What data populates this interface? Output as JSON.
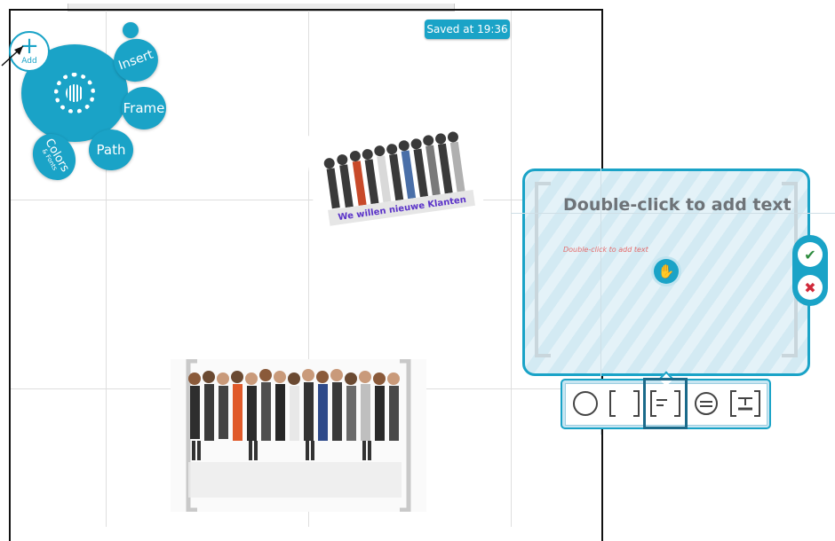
{
  "saved_badge": "Saved at 19:36",
  "bubble_menu": {
    "add_label": "Add",
    "insert": "Insert",
    "frame": "Frame",
    "path": "Path",
    "colors": "Colors",
    "colors_sub": "& Fonts"
  },
  "image_caption": "We willen nieuwe Klanten",
  "text_panel": {
    "title": "Double-click to add text",
    "subtitle": "Double-click to add text"
  },
  "icons": {
    "add": "plus-icon",
    "zoom": "zoom-ring-icon",
    "hand": "hand-icon",
    "confirm": "check-icon",
    "cancel": "close-icon"
  },
  "colors": {
    "accent": "#1aa3c7",
    "caption": "#5a32c8"
  }
}
